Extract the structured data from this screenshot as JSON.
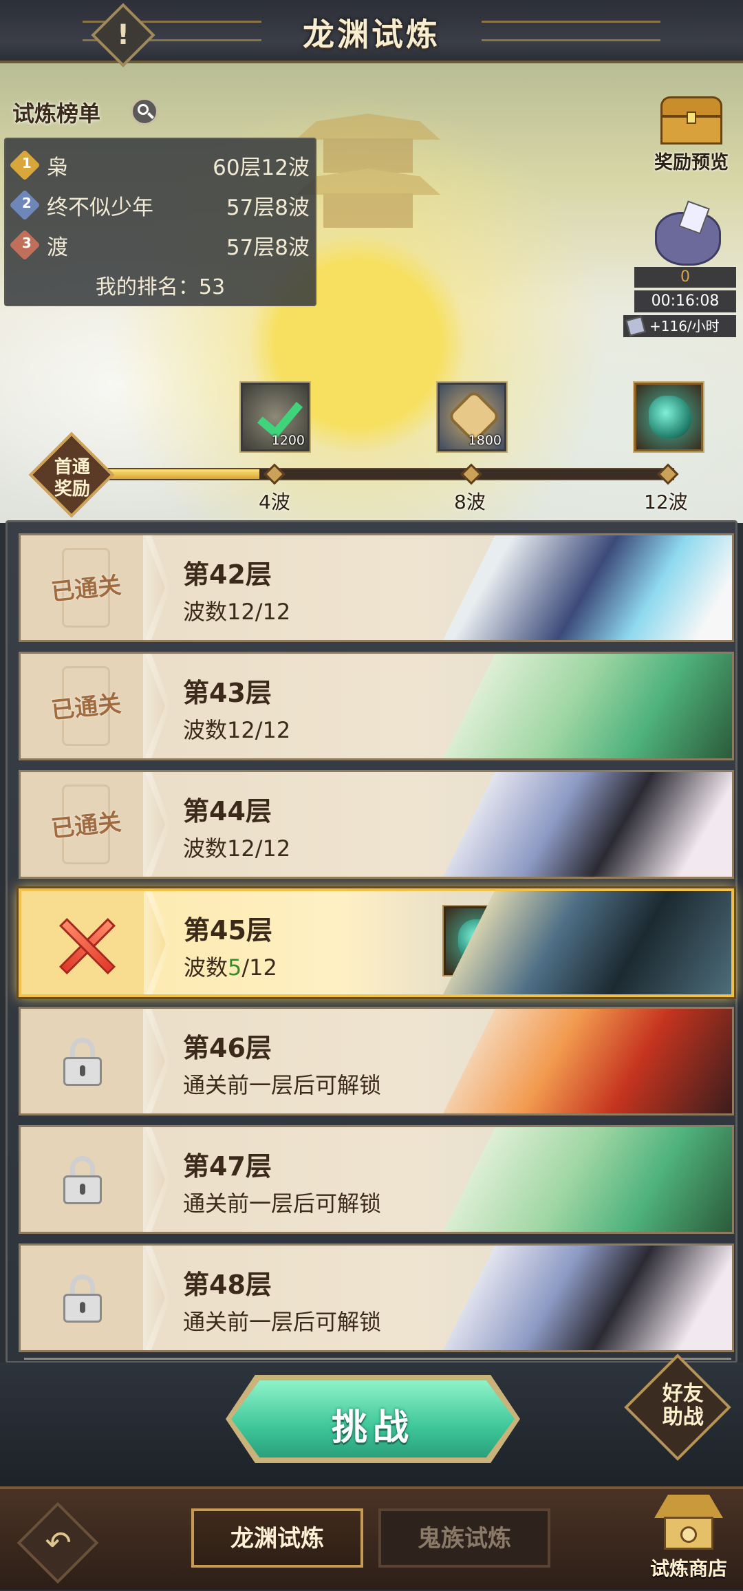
{
  "header": {
    "title": "龙渊试炼",
    "info_icon": "!"
  },
  "leaderboard": {
    "title": "试炼榜单",
    "rows": [
      {
        "rank": "1",
        "name": "枭",
        "score": "60层12波",
        "medal_color": "#d8a63a"
      },
      {
        "rank": "2",
        "name": "终不似少年",
        "score": "57层8波",
        "medal_color": "#6f86b8"
      },
      {
        "rank": "3",
        "name": "渡",
        "score": "57层8波",
        "medal_color": "#c0705a"
      }
    ],
    "my_rank": "我的排名：53"
  },
  "side": {
    "reward_preview_label": "奖励预览",
    "bag_count": "0",
    "bag_timer": "00:16:08",
    "bag_rate": "+116/小时"
  },
  "first_clear": {
    "badge": "首通奖励",
    "progress": 0.29,
    "rewards": [
      {
        "amount": "1200",
        "label": "4波",
        "claimed": true,
        "icon": "check-icon"
      },
      {
        "amount": "1800",
        "label": "8波",
        "claimed": false,
        "icon": "coin-icon"
      },
      {
        "amount": "",
        "label": "12波",
        "claimed": false,
        "icon": "gem-icon"
      }
    ]
  },
  "floors": [
    {
      "title": "第42层",
      "status": "已通关",
      "sub": "波数12/12"
    },
    {
      "title": "第43层",
      "status": "已通关",
      "sub": "波数12/12"
    },
    {
      "title": "第44层",
      "status": "已通关",
      "sub": "波数12/12"
    },
    {
      "title": "第45层",
      "status": "current",
      "sub_prefix": "波数",
      "wave_current": "5",
      "wave_total": "/12"
    },
    {
      "title": "第46层",
      "status": "locked",
      "sub": "通关前一层后可解锁"
    },
    {
      "title": "第47层",
      "status": "locked",
      "sub": "通关前一层后可解锁"
    },
    {
      "title": "第48层",
      "status": "locked",
      "sub": "通关前一层后可解锁"
    }
  ],
  "actions": {
    "challenge": "挑战",
    "friend_assist": "好友助战"
  },
  "bottom_nav": {
    "back_icon": "↶",
    "tabs": [
      "龙渊试炼",
      "鬼族试炼"
    ],
    "shop_label": "试炼商店"
  },
  "colors": {
    "accent_green": "#3a8b28",
    "gold": "#f1c24a"
  }
}
